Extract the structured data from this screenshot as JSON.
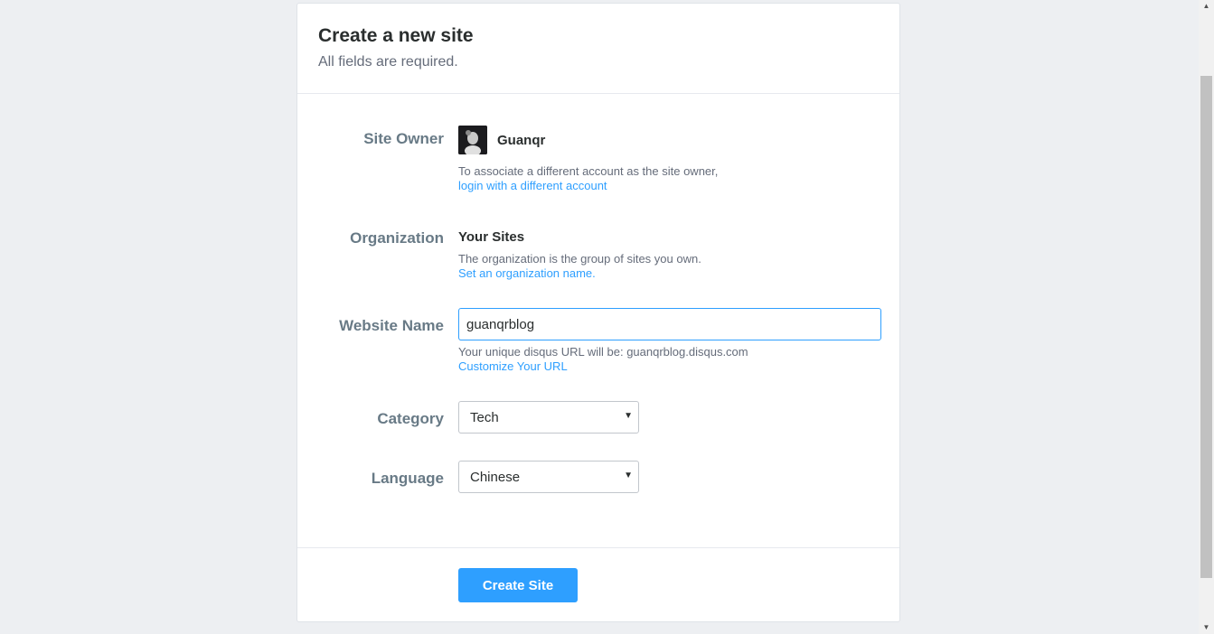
{
  "header": {
    "title": "Create a new site",
    "subtitle": "All fields are required."
  },
  "site_owner": {
    "label": "Site Owner",
    "name": "Guanqr",
    "help": "To associate a different account as the site owner,",
    "link": "login with a different account"
  },
  "organization": {
    "label": "Organization",
    "name": "Your Sites",
    "help": "The organization is the group of sites you own.",
    "link": "Set an organization name."
  },
  "website_name": {
    "label": "Website Name",
    "value": "guanqrblog",
    "help": "Your unique disqus URL will be: guanqrblog.disqus.com",
    "link": "Customize Your URL"
  },
  "category": {
    "label": "Category",
    "selected": "Tech"
  },
  "language": {
    "label": "Language",
    "selected": "Chinese"
  },
  "footer": {
    "submit_label": "Create Site"
  },
  "colors": {
    "accent": "#2e9fff",
    "label": "#687a86",
    "background": "#edeff2"
  }
}
